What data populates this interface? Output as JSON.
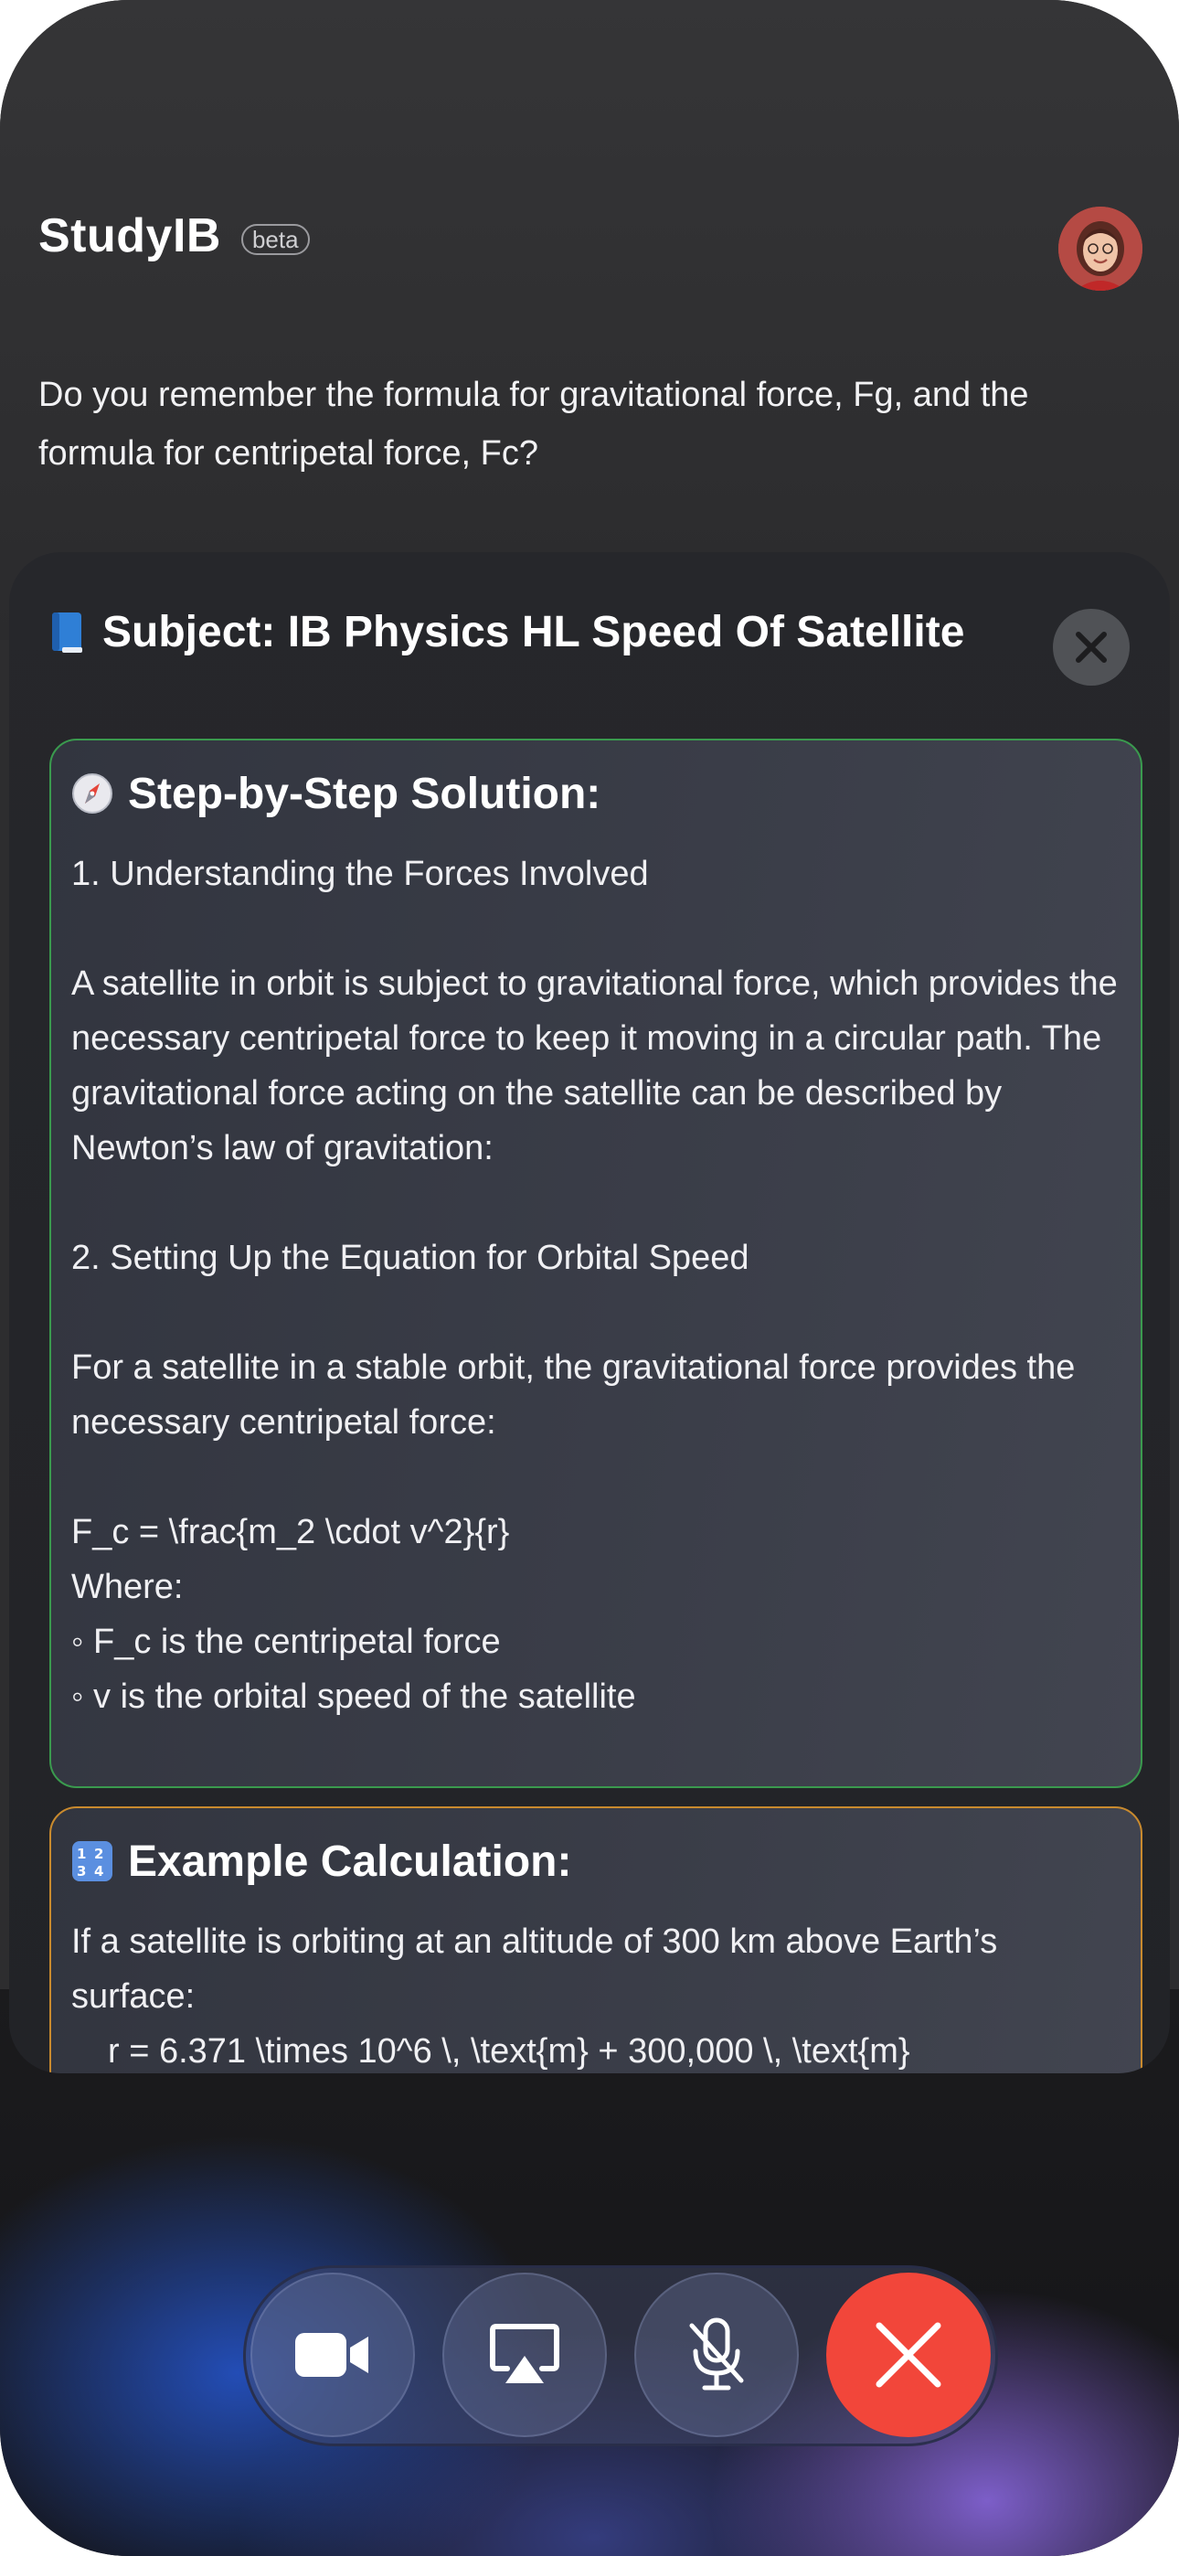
{
  "header": {
    "app_title": "StudyIB",
    "badge": "beta"
  },
  "assistant_message": "Do you remember the formula for gravitational force, Fg, and the formula for centripetal force, Fc?",
  "sheet": {
    "title": "Subject: IB Physics HL Speed Of Satellite",
    "icon": "blue-book-icon",
    "close_icon": "close-icon"
  },
  "solution_card": {
    "icon": "compass-icon",
    "border_color": "#3a9a4e",
    "title": "Step-by-Step Solution:",
    "step1_heading": "1. Understanding the Forces Involved",
    "step1_text": "A satellite in orbit is subject to gravitational force, which provides the necessary centripetal force to keep it moving in a circular path. The gravitational force acting on the satellite can be described by Newton’s law of gravitation:",
    "step2_heading": "2. Setting Up the Equation for Orbital Speed",
    "step2_text": "For a satellite in a stable orbit, the gravitational force provides the necessary centripetal force:",
    "formula": "F_c = \\frac{m_2 \\cdot v^2}{r}",
    "where_label": "Where:",
    "bullets": [
      "◦ F_c is the centripetal force",
      "◦ v is the orbital speed of the satellite"
    ]
  },
  "example_card": {
    "icon": "numbers-1234-icon",
    "border_color": "#c98a2e",
    "title": "Example Calculation:",
    "text": "If a satellite is orbiting at an altitude of 300 km above Earth’s surface:",
    "cutoff_line": "r = 6.371 \\times 10^6 \\, \\text{m} + 300,000 \\, \\text{m}"
  },
  "call_controls": {
    "video_icon": "video-camera-icon",
    "airplay_icon": "screen-share-icon",
    "mute_icon": "microphone-muted-icon",
    "end_icon": "end-call-icon",
    "end_color": "#f2463a"
  }
}
